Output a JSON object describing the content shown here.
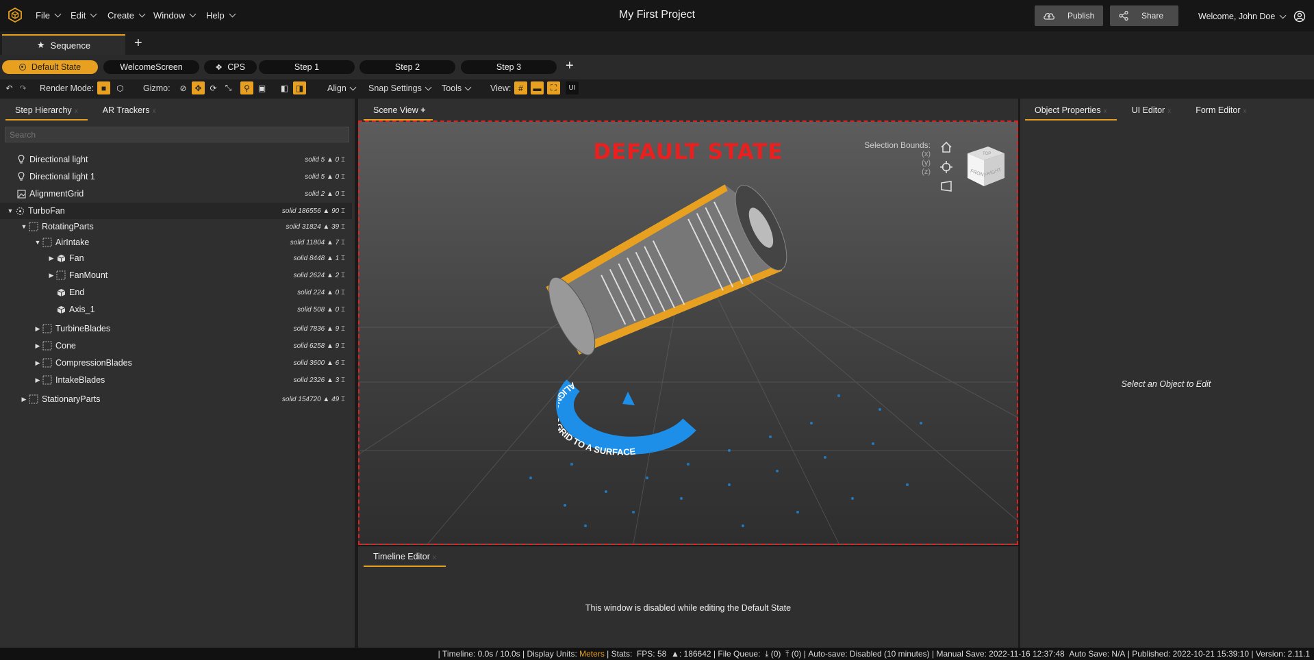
{
  "menu": {
    "logo_icon": "cube-logo-icon",
    "items": [
      {
        "label": "File"
      },
      {
        "label": "Edit"
      },
      {
        "label": "Create"
      },
      {
        "label": "Window"
      },
      {
        "label": "Help"
      }
    ],
    "project_title": "My First Project",
    "publish_label": "Publish",
    "share_label": "Share",
    "welcome": "Welcome, John Doe"
  },
  "sequence": {
    "tab_label": "Sequence"
  },
  "steps": [
    {
      "label": "Default State",
      "active": true
    },
    {
      "label": "WelcomeScreen"
    },
    {
      "label": "CPS"
    },
    {
      "label": "Step 1"
    },
    {
      "label": "Step 2"
    },
    {
      "label": "Step 3"
    }
  ],
  "toolbar": {
    "render_mode_label": "Render Mode:",
    "gizmo_label": "Gizmo:",
    "align_label": "Align",
    "snap_label": "Snap Settings",
    "tools_label": "Tools",
    "view_label": "View:",
    "ui_label": "UI"
  },
  "left_panel": {
    "tabs": [
      {
        "label": "Step Hierarchy"
      },
      {
        "label": "AR Trackers"
      }
    ],
    "search_placeholder": "Search",
    "tree": [
      {
        "name": "Directional light",
        "stats": "solid 5 ▲ 0"
      },
      {
        "name": "Directional light 1",
        "stats": "solid 5 ▲ 0"
      },
      {
        "name": "AlignmentGrid",
        "stats": "solid 2 ▲ 0"
      },
      {
        "name": "TurboFan",
        "stats": "solid 186556 ▲ 90"
      },
      {
        "name": "RotatingParts",
        "stats": "solid 31824 ▲ 39"
      },
      {
        "name": "AirIntake",
        "stats": "solid 11804 ▲ 7"
      },
      {
        "name": "Fan",
        "stats": "solid 8448 ▲ 1"
      },
      {
        "name": "FanMount",
        "stats": "solid 2624 ▲ 2"
      },
      {
        "name": "End",
        "stats": "solid 224 ▲ 0"
      },
      {
        "name": "Axis_1",
        "stats": "solid 508 ▲ 0"
      },
      {
        "name": "TurbineBlades",
        "stats": "solid 7836 ▲ 9"
      },
      {
        "name": "Cone",
        "stats": "solid 6258 ▲ 9"
      },
      {
        "name": "CompressionBlades",
        "stats": "solid 3600 ▲ 6"
      },
      {
        "name": "IntakeBlades",
        "stats": "solid 2326 ▲ 3"
      },
      {
        "name": "StationaryParts",
        "stats": "solid 154720 ▲ 49"
      }
    ]
  },
  "scene": {
    "tab_label": "Scene View",
    "state_label": "DEFAULT STATE",
    "selection_bounds_label": "Selection Bounds:",
    "axes": [
      "(x)",
      "(y)",
      "(z)"
    ],
    "cube_front": "FRONT",
    "cube_right": "RIGHT",
    "cube_top": "TOP",
    "grid_text": "ALIGN THIS GRID TO A SURFACE"
  },
  "timeline": {
    "tab_label": "Timeline Editor",
    "message": "This window is disabled while editing the Default State"
  },
  "right_panel": {
    "tabs": [
      {
        "label": "Object Properties"
      },
      {
        "label": "UI Editor"
      },
      {
        "label": "Form Editor"
      }
    ],
    "empty_message": "Select an Object to Edit"
  },
  "status": {
    "timeline": "Timeline: 0.0s / 10.0s",
    "display_units_label": "Display Units:",
    "display_units_value": "Meters",
    "stats": "Stats:  FPS: 58  ▲: 186642",
    "file_queue": "File Queue:",
    "queue_down": "(0)",
    "queue_up": "(0)",
    "autosave": "Auto-save: Disabled (10 minutes)",
    "manual_save": "Manual Save: 2022-11-16 12:37:48",
    "auto_save": "Auto Save: N/A",
    "published": "Published: 2022-10-21 15:39:10",
    "version": "Version: 2.11.1"
  },
  "colors": {
    "accent": "#e8a020",
    "state_red": "#e82020",
    "grid_blue": "#1e8fe8"
  }
}
